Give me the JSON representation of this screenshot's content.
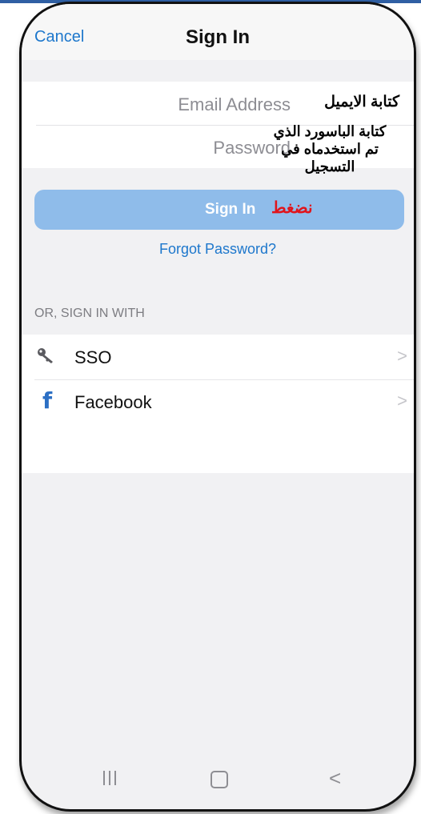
{
  "header": {
    "cancel_label": "Cancel",
    "title": "Sign In"
  },
  "form": {
    "email_placeholder": "Email Address",
    "password_placeholder": "Password"
  },
  "annotations": {
    "email": "كتابة الايميل",
    "password_line1": "كتابة الباسورد الذي",
    "password_line2": "تم استخدماه في",
    "password_line3": "التسجيل",
    "press": "نضغط"
  },
  "signin_button": {
    "label": "Sign In",
    "color": "#8fbcea"
  },
  "forgot_password": "Forgot Password?",
  "alt_signin": {
    "section_label": "OR, SIGN IN WITH",
    "items": [
      {
        "label": "SSO",
        "icon": "key-icon"
      },
      {
        "label": "Facebook",
        "icon": "facebook-icon"
      }
    ]
  },
  "navbar": {
    "icons": [
      "recent-apps-icon",
      "home-icon",
      "back-icon"
    ],
    "back_glyph": "<"
  },
  "colors": {
    "accent": "#1d77cc",
    "annotation_red": "#e1141b"
  }
}
